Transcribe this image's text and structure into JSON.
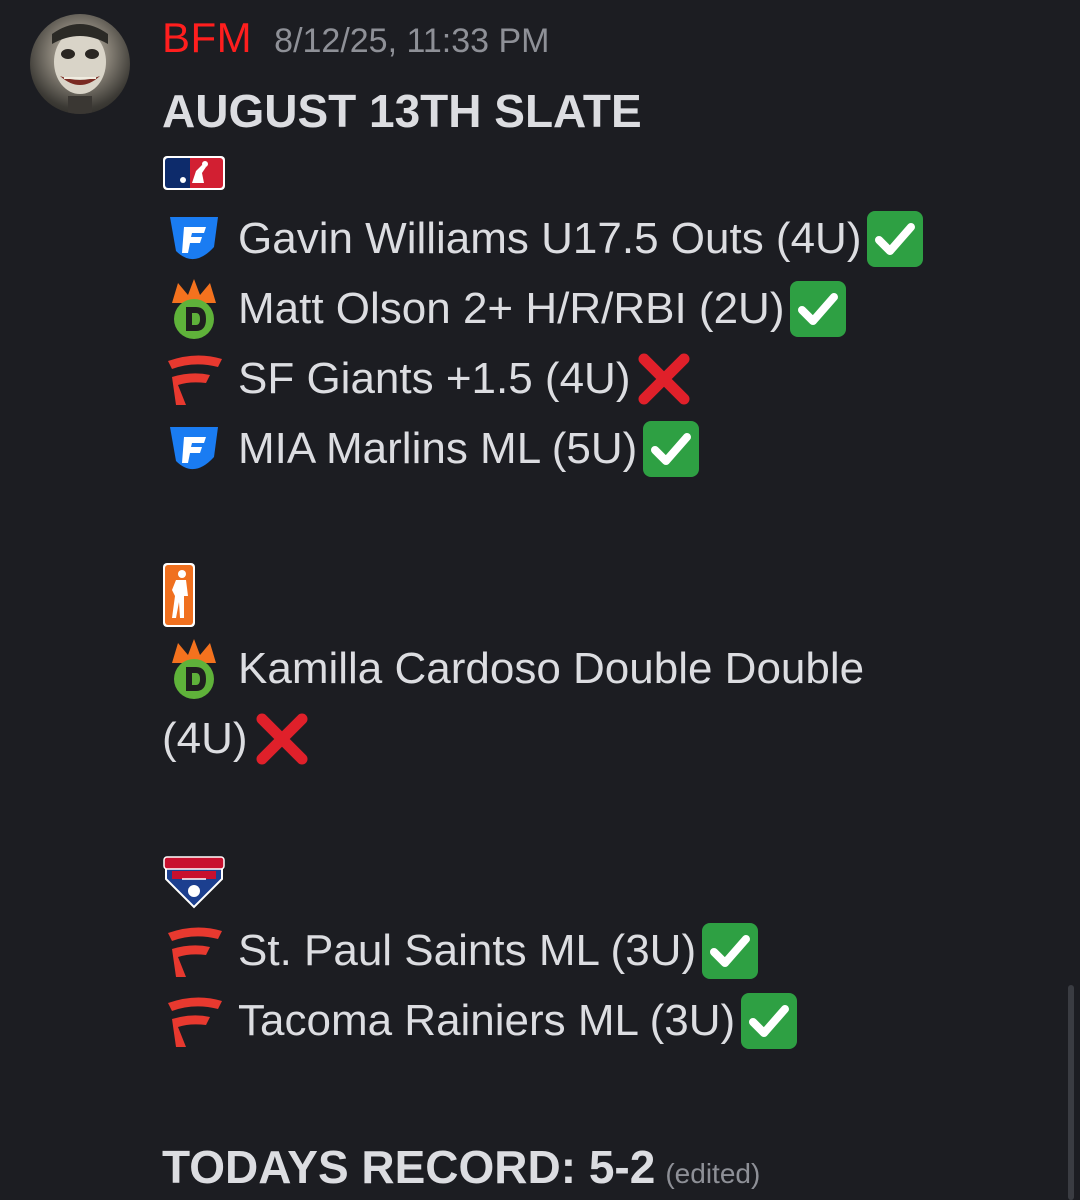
{
  "author": {
    "username": "BFM",
    "timestamp": "8/12/25, 11:33 PM",
    "name_color": "#ff1e1e"
  },
  "message": {
    "title": "AUGUST 13TH SLATE",
    "sections": [
      {
        "league_icon": "mlb-logo-icon",
        "picks": [
          {
            "book": "fanduel-icon",
            "text": "Gavin Williams U17.5 Outs (4U)",
            "result": "win-check-icon"
          },
          {
            "book": "draftkings-icon",
            "text": "Matt Olson 2+ H/R/RBI (2U)",
            "result": "win-check-icon"
          },
          {
            "book": "fanatics-icon",
            "text": "SF Giants +1.5 (4U)",
            "result": "loss-x-icon"
          },
          {
            "book": "fanduel-icon",
            "text": "MIA Marlins ML (5U)",
            "result": "win-check-icon"
          }
        ]
      },
      {
        "league_icon": "wnba-logo-icon",
        "picks": [
          {
            "book": "draftkings-icon",
            "text": "Kamilla Cardoso Double Double",
            "text_cont": "(4U)",
            "result": "loss-x-icon"
          }
        ]
      },
      {
        "league_icon": "international-league-logo-icon",
        "picks": [
          {
            "book": "fanatics-icon",
            "text": "St. Paul Saints ML (3U)",
            "result": "win-check-icon"
          },
          {
            "book": "fanatics-icon",
            "text": "Tacoma Rainiers ML (3U)",
            "result": "win-check-icon"
          }
        ]
      }
    ],
    "record": "TODAYS RECORD: 5-2",
    "edited_label": "(edited)"
  },
  "colors": {
    "background": "#1c1d22",
    "text": "#dcdde1",
    "muted": "#8e9097",
    "check_green": "#2ea043",
    "cross_red": "#e0202a",
    "fanduel_blue": "#1a7cf2",
    "fanatics_red": "#e8392f",
    "draftkings_orange": "#f4721e",
    "draftkings_green": "#5fb23a"
  }
}
